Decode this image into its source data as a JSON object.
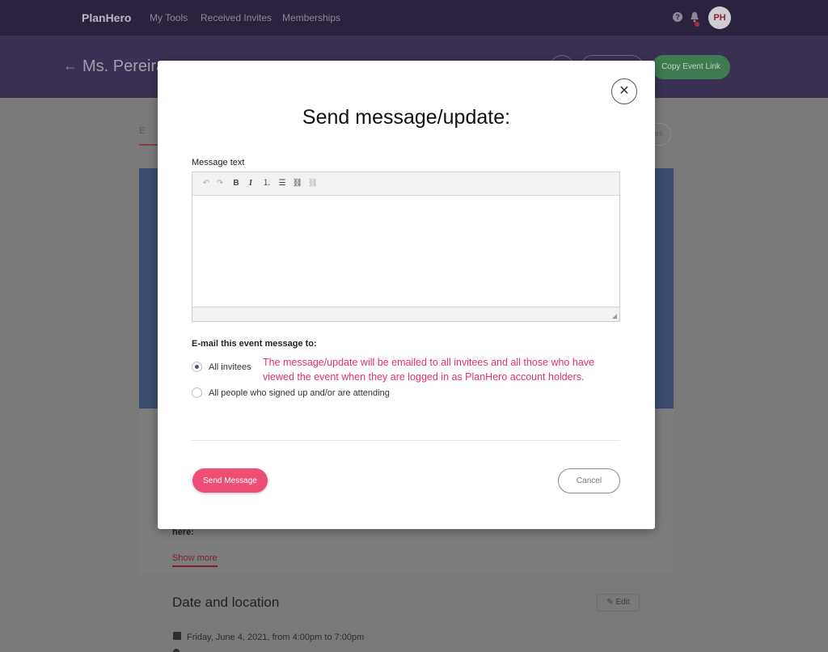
{
  "app": {
    "brand": "PlanHero"
  },
  "nav": {
    "links": [
      "My Tools",
      "Received Invites",
      "Memberships"
    ],
    "help_glyph": "?",
    "avatar_initials": "PH"
  },
  "event": {
    "title": "Ms. Pereira",
    "copy_link_label": "Copy Event Link",
    "tab_peek": "E",
    "pill_peek": "es",
    "here_text": "here:",
    "show_more": "Show more",
    "date_heading": "Date and location",
    "edit_label": "✎ Edit",
    "date_line": "Friday, June 4, 2021, from 4:00pm to 7:00pm"
  },
  "modal": {
    "title": "Send message/update:",
    "close_glyph": "✕",
    "message_label": "Message text",
    "editor_value": "",
    "toolbar": [
      {
        "name": "undo-button",
        "glyph": "↶",
        "icon": "undo-icon"
      },
      {
        "name": "redo-button",
        "glyph": "↷",
        "icon": "redo-icon"
      },
      {
        "name": "bold-button",
        "glyph": "B",
        "icon": "bold-icon"
      },
      {
        "name": "italic-button",
        "glyph": "I",
        "icon": "italic-icon"
      },
      {
        "name": "numbered-list-button",
        "glyph": "⒈",
        "icon": "numbered-list-icon"
      },
      {
        "name": "bullet-list-button",
        "glyph": "☰",
        "icon": "bullet-list-icon"
      },
      {
        "name": "link-button",
        "glyph": "⛓",
        "icon": "link-icon"
      },
      {
        "name": "unlink-button",
        "glyph": "⛓",
        "icon": "unlink-icon"
      }
    ],
    "email_label": "E-mail this event message to:",
    "options": [
      {
        "label": "All invitees",
        "checked": true
      },
      {
        "label": "All people who signed up and/or are attending",
        "checked": false
      }
    ],
    "note": "The message/update will be emailed to all invitees and all those who have viewed the event when they are logged in as PlanHero account holders.",
    "send_label": "Send Message",
    "cancel_label": "Cancel",
    "colors": {
      "send": "#ef4e74",
      "note": "#e0306a",
      "radio": "#5b4a8c"
    }
  }
}
